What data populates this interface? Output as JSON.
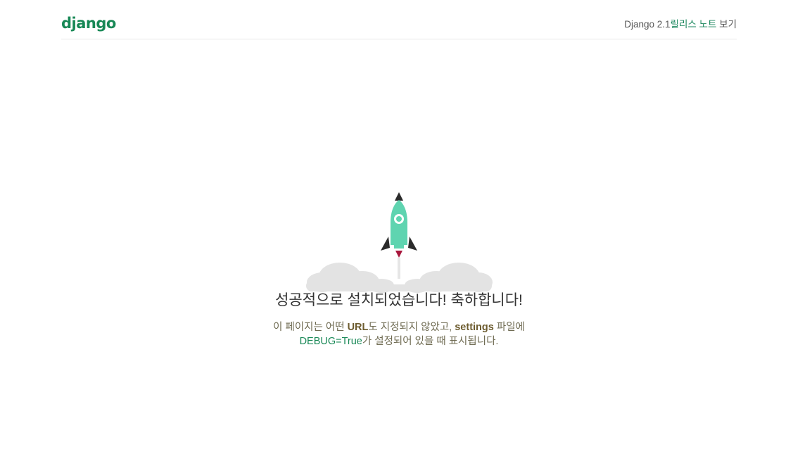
{
  "header": {
    "logo": "django",
    "version_text": "Django 2.1",
    "release_link": "릴리스 노트",
    "view_suffix": "보기"
  },
  "main": {
    "headline": "성공적으로 설치되었습니다! 축하합니다!",
    "desc_part1": "이 페이지는 어떤 ",
    "desc_url": "URL",
    "desc_part2": "도 지정되지 않았고, ",
    "desc_settings": "settings",
    "desc_part3": " 파일에",
    "desc_debug": "DEBUG=True",
    "desc_part4": "가 설정되어 있을 때 표시됩니다."
  },
  "colors": {
    "brand_green": "#188856",
    "rocket_body": "#5fd4b0",
    "rocket_dark": "#2b2b2b",
    "rocket_flame": "#a8173d",
    "cloud": "#e3e3e3"
  },
  "icons": {
    "illustration": "rocket-launch-icon"
  }
}
